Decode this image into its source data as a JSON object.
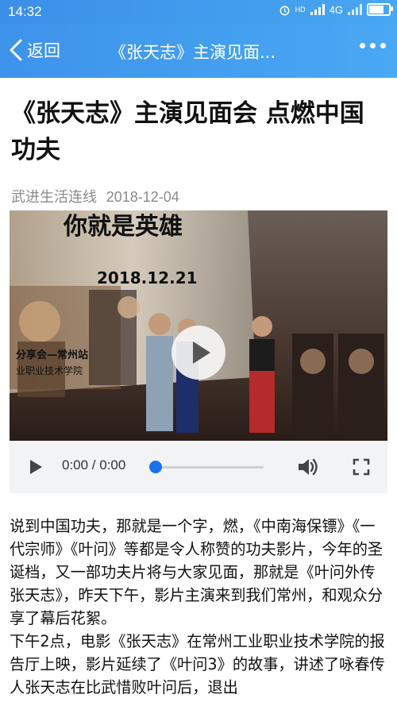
{
  "status_bar": {
    "time": "14:32",
    "network": "4G",
    "hd": "HD",
    "battery_level": 0.8
  },
  "nav": {
    "back_label": "返回",
    "title": "《张天志》主演见面...",
    "more_icon": "more-dots-icon"
  },
  "article": {
    "headline": "《张天志》主演见面会 点燃中国功夫",
    "source": "武进生活连线",
    "date": "2018-12-04"
  },
  "video": {
    "poster_text": "你就是英雄",
    "poster_date": "2018.12.21",
    "poster_left_text": "分享会—常州站",
    "poster_left_text2": "业职业技术学院",
    "current_time": "0:00 / 0:00",
    "progress": 0
  },
  "body": {
    "paragraphs": [
      "说到中国功夫，那就是一个字，燃，《中南海保镖》《一代宗师》《叶问》等都是令人称赞的功夫影片，今年的圣诞档，又一部功夫片将与大家见面，那就是《叶问外传张天志》，昨天下午，影片主演来到我们常州，和观众分享了幕后花絮。",
      "下午2点，电影《张天志》在常州工业职业技术学院的报告厅上映，影片延续了《叶问3》的故事，讲述了咏春传人张天志在比武惜败叶问后，退出"
    ]
  },
  "colors": {
    "nav_bg": "#4199ee",
    "accent": "#1a73e8",
    "meta_gray": "#8a8a8a"
  }
}
